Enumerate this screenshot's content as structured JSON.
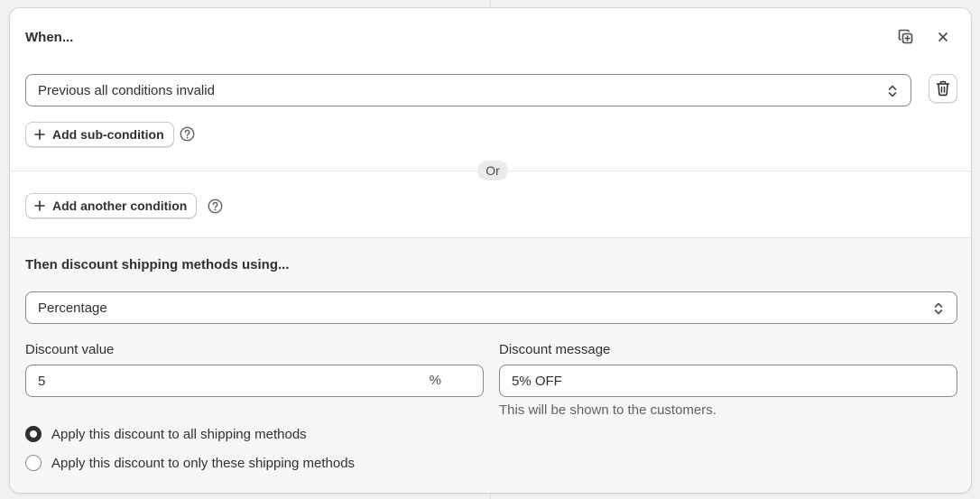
{
  "condition": {
    "title": "When...",
    "select_value": "Previous all conditions invalid",
    "add_sub_condition_label": "Add sub-condition",
    "or_label": "Or",
    "add_another_condition_label": "Add another condition"
  },
  "discount": {
    "title": "Then discount shipping methods using...",
    "type_value": "Percentage",
    "value_label": "Discount value",
    "value": "5",
    "value_suffix": "%",
    "message_label": "Discount message",
    "message_value": "5% OFF",
    "message_help": "This will be shown to the customers.",
    "apply_options": [
      {
        "label": "Apply this discount to all shipping methods",
        "checked": true
      },
      {
        "label": "Apply this discount to only these shipping methods",
        "checked": false
      }
    ]
  },
  "icons": {
    "duplicate": "duplicate-icon",
    "close": "close-icon",
    "trash": "trash-icon",
    "chevron": "chevron-up-down-icon",
    "plus": "plus-icon",
    "help": "question-circle-icon"
  },
  "colors": {
    "text": "#303030",
    "border": "#8a8a8a",
    "section_bg": "#f7f7f7"
  }
}
